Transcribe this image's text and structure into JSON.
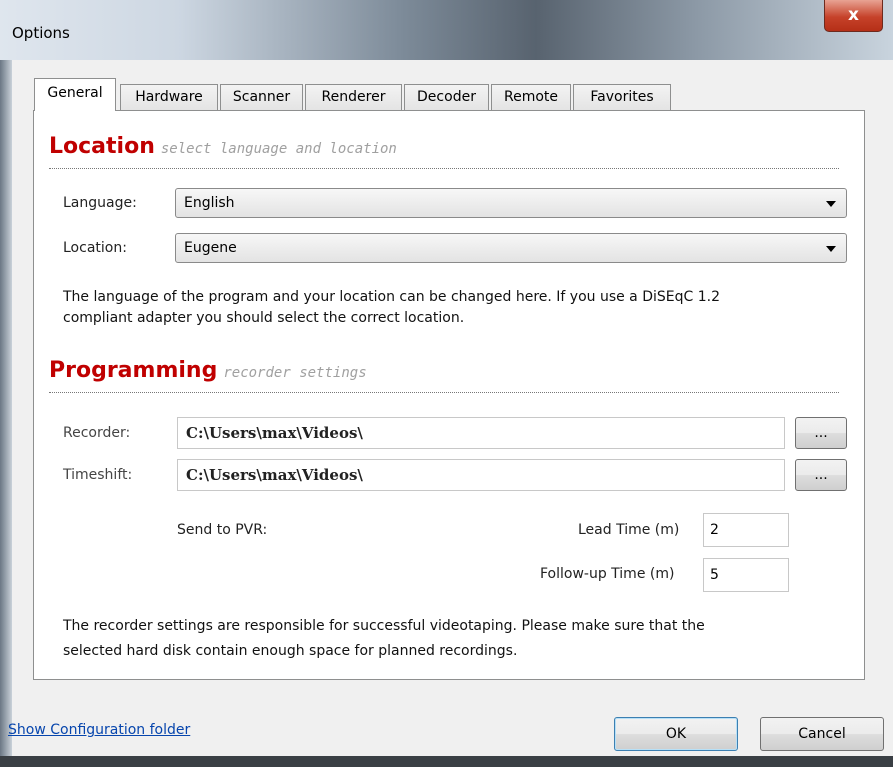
{
  "window": {
    "title": "Options",
    "close_glyph": "x"
  },
  "tabs": [
    {
      "label": "General",
      "active": true
    },
    {
      "label": "Hardware"
    },
    {
      "label": "Scanner"
    },
    {
      "label": "Renderer"
    },
    {
      "label": "Decoder"
    },
    {
      "label": "Remote"
    },
    {
      "label": "Favorites"
    }
  ],
  "location": {
    "title": "Location",
    "subtitle": "select language and location",
    "language_label": "Language:",
    "language_value": "English",
    "location_label": "Location:",
    "location_value": "Eugene",
    "description_line1": "The language of the program and your location can be changed here. If you use a DiSEqC 1.2",
    "description_line2": "compliant adapter you should select the correct location."
  },
  "programming": {
    "title": "Programming",
    "subtitle": "recorder settings",
    "recorder_label": "Recorder:",
    "recorder_value": "C:\\Users\\max\\Videos\\",
    "timeshift_label": "Timeshift:",
    "timeshift_value": "C:\\Users\\max\\Videos\\",
    "browse_label": "...",
    "send_to_pvr_label": "Send to PVR:",
    "lead_time_label": "Lead Time (m)",
    "lead_time_value": "2",
    "followup_label": "Follow-up Time (m)",
    "followup_value": "5",
    "description_line1": "The recorder settings are responsible for successful videotaping. Please make sure that the",
    "description_line2": "selected hard disk contain enough space for planned recordings."
  },
  "footer": {
    "config_link": "Show Configuration folder",
    "ok_label": "OK",
    "cancel_label": "Cancel"
  },
  "colors": {
    "section_title": "#c00000",
    "link": "#0645ad",
    "close_button": "#c6422a"
  }
}
